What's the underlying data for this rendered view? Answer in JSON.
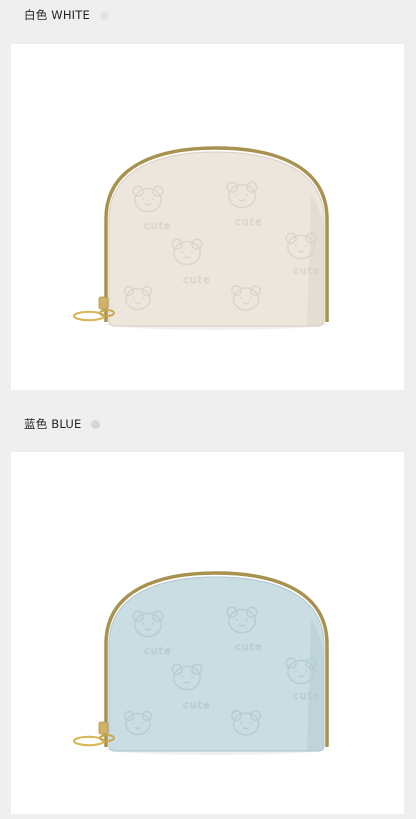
{
  "variants": [
    {
      "label": "白色 WHITE",
      "swatch_color": "#e3e3e1",
      "wallet_color": "#ede6dc",
      "wallet_shade": "#dcd3c7",
      "emboss_text": "cute",
      "icons": [
        "wallet-image",
        "bear-pattern",
        "zipper-pull"
      ]
    },
    {
      "label": "蓝色 BLUE",
      "swatch_color": "#cfd8df",
      "wallet_color": "#c9dde3",
      "wallet_shade": "#b5cbd2",
      "emboss_text": "cute",
      "icons": [
        "wallet-image",
        "bear-pattern",
        "zipper-pull"
      ]
    }
  ]
}
